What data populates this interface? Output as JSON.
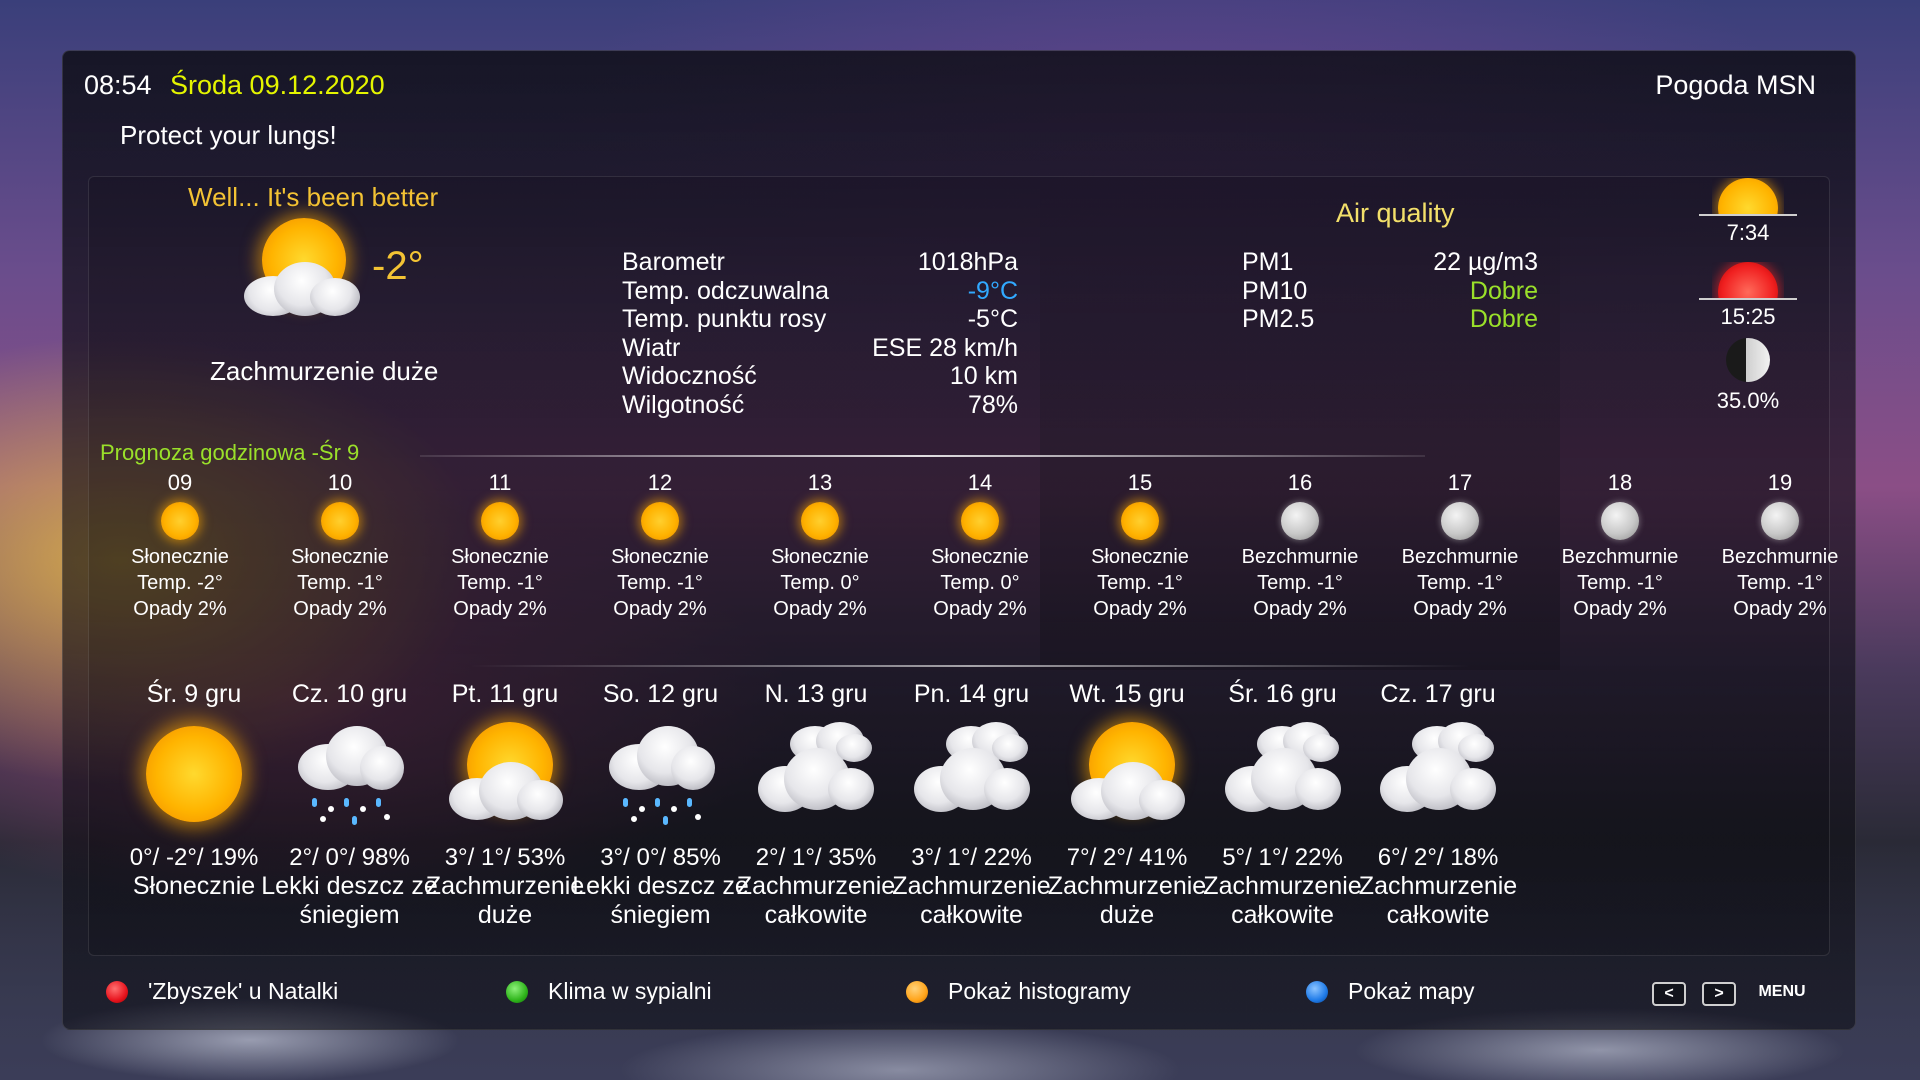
{
  "header": {
    "time": "08:54",
    "date": "Środa 09.12.2020",
    "source": "Pogoda MSN",
    "subtitle": "Protect your lungs!"
  },
  "current": {
    "mood": "Well... It's been better",
    "temp": "-2°",
    "description": "Zachmurzenie duże",
    "icon": "sun-behind-cloud-icon",
    "details": [
      {
        "label": "Barometr",
        "value": "1018hPa",
        "color": "#ffffff"
      },
      {
        "label": "Temp. odczuwalna",
        "value": "-9°C",
        "color": "#31a9ff"
      },
      {
        "label": "Temp. punktu rosy",
        "value": "-5°C",
        "color": "#ffffff"
      },
      {
        "label": "Wiatr",
        "value": "ESE 28 km/h",
        "color": "#ffffff"
      },
      {
        "label": "Widoczność",
        "value": "10 km",
        "color": "#ffffff"
      },
      {
        "label": "Wilgotność",
        "value": "78%",
        "color": "#ffffff"
      }
    ]
  },
  "air_quality": {
    "title": "Air quality",
    "rows": [
      {
        "label": "PM1",
        "value": "22 µg/m3"
      },
      {
        "label": "PM10",
        "value": "Dobre"
      },
      {
        "label": "PM2.5",
        "value": "Dobre"
      }
    ]
  },
  "sun_moon": {
    "sunrise": "7:34",
    "sunset": "15:25",
    "moon": "35.0%"
  },
  "hourly": {
    "title": "Prognoza godzinowa -Śr 9",
    "items": [
      {
        "hour": "09",
        "desc": "Słonecznie",
        "temp": "Temp. -2°",
        "rain": "Opady 2%",
        "icon": "sun"
      },
      {
        "hour": "10",
        "desc": "Słonecznie",
        "temp": "Temp. -1°",
        "rain": "Opady 2%",
        "icon": "sun"
      },
      {
        "hour": "11",
        "desc": "Słonecznie",
        "temp": "Temp. -1°",
        "rain": "Opady 2%",
        "icon": "sun"
      },
      {
        "hour": "12",
        "desc": "Słonecznie",
        "temp": "Temp. -1°",
        "rain": "Opady 2%",
        "icon": "sun"
      },
      {
        "hour": "13",
        "desc": "Słonecznie",
        "temp": "Temp. 0°",
        "rain": "Opady 2%",
        "icon": "sun"
      },
      {
        "hour": "14",
        "desc": "Słonecznie",
        "temp": "Temp. 0°",
        "rain": "Opady 2%",
        "icon": "sun"
      },
      {
        "hour": "15",
        "desc": "Słonecznie",
        "temp": "Temp. -1°",
        "rain": "Opady 2%",
        "icon": "sun"
      },
      {
        "hour": "16",
        "desc": "Bezchmurnie",
        "temp": "Temp. -1°",
        "rain": "Opady 2%",
        "icon": "moon"
      },
      {
        "hour": "17",
        "desc": "Bezchmurnie",
        "temp": "Temp. -1°",
        "rain": "Opady 2%",
        "icon": "moon"
      },
      {
        "hour": "18",
        "desc": "Bezchmurnie",
        "temp": "Temp. -1°",
        "rain": "Opady 2%",
        "icon": "moon"
      },
      {
        "hour": "19",
        "desc": "Bezchmurnie",
        "temp": "Temp. -1°",
        "rain": "Opady 2%",
        "icon": "moon"
      }
    ]
  },
  "daily": [
    {
      "day": "Śr. 9 gru",
      "temps": "0°/ -2°/ 19%",
      "desc": "Słonecznie",
      "icon": "sun"
    },
    {
      "day": "Cz. 10 gru",
      "temps": "2°/ 0°/ 98%",
      "desc": "Lekki deszcz ze śniegiem",
      "icon": "sleet"
    },
    {
      "day": "Pt. 11 gru",
      "temps": "3°/ 1°/ 53%",
      "desc": "Zachmurzenie duże",
      "icon": "partly"
    },
    {
      "day": "So. 12 gru",
      "temps": "3°/ 0°/ 85%",
      "desc": "Lekki deszcz ze śniegiem",
      "icon": "sleet"
    },
    {
      "day": "N. 13 gru",
      "temps": "2°/ 1°/ 35%",
      "desc": "Zachmurzenie całkowite",
      "icon": "cloudy"
    },
    {
      "day": "Pn. 14 gru",
      "temps": "3°/ 1°/ 22%",
      "desc": "Zachmurzenie całkowite",
      "icon": "cloudy"
    },
    {
      "day": "Wt. 15 gru",
      "temps": "7°/ 2°/ 41%",
      "desc": "Zachmurzenie duże",
      "icon": "partly"
    },
    {
      "day": "Śr. 16 gru",
      "temps": "5°/ 1°/ 22%",
      "desc": "Zachmurzenie całkowite",
      "icon": "cloudy"
    },
    {
      "day": "Cz. 17 gru",
      "temps": "6°/ 2°/ 18%",
      "desc": "Zachmurzenie całkowite",
      "icon": "cloudy"
    }
  ],
  "footer": {
    "buttons": [
      {
        "label": "'Zbyszek' u Natalki",
        "color": "#e8141e"
      },
      {
        "label": "Klima w sypialni",
        "color": "#2fb51b"
      },
      {
        "label": "Pokaż histogramy",
        "color": "#ffa41a"
      },
      {
        "label": "Pokaż mapy",
        "color": "#1f7be8"
      }
    ],
    "prev": "<",
    "next": ">",
    "menu": "MENU"
  },
  "colors": {
    "accent_yellow": "#f3c334",
    "accent_green": "#9ae02a",
    "date_yellow": "#e4f500",
    "feels_like_blue": "#31a9ff"
  }
}
